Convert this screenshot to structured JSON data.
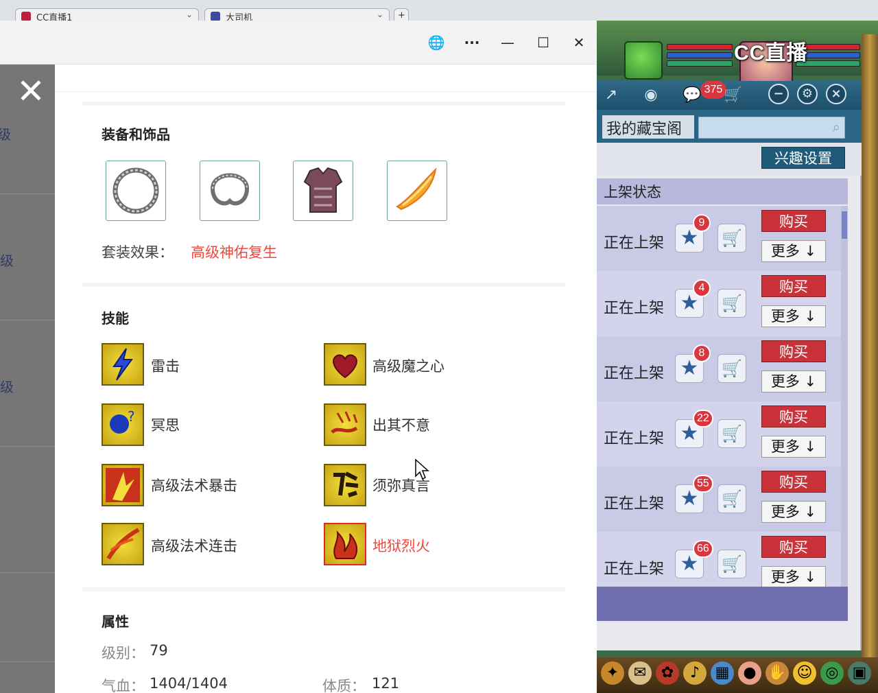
{
  "browser_tabs": [
    {
      "label": "CC直播1"
    },
    {
      "label": "大司机"
    }
  ],
  "game": {
    "logo": "CC直播",
    "message_count": "375",
    "tab_label": "我的藏宝阁",
    "interest_button": "兴趣设置",
    "status_header": "上架状态",
    "rows": [
      {
        "status": "正在上架",
        "count": "9",
        "buy": "购买",
        "more": "更多"
      },
      {
        "status": "正在上架",
        "count": "4",
        "buy": "购买",
        "more": "更多"
      },
      {
        "status": "正在上架",
        "count": "8",
        "buy": "购买",
        "more": "更多"
      },
      {
        "status": "正在上架",
        "count": "22",
        "buy": "购买",
        "more": "更多"
      },
      {
        "status": "正在上架",
        "count": "55",
        "buy": "购买",
        "more": "更多"
      },
      {
        "status": "正在上架",
        "count": "66",
        "buy": "购买",
        "more": "更多"
      }
    ]
  },
  "left_page": {
    "level_labels": [
      "级",
      "级",
      "级"
    ]
  },
  "popup": {
    "equip_section_title": "装备和饰品",
    "set_effect_label": "套装效果：",
    "set_effect_value": "高级神佑复生",
    "skills_section_title": "技能",
    "skills": [
      {
        "name": "雷击"
      },
      {
        "name": "高级魔之心"
      },
      {
        "name": "冥思"
      },
      {
        "name": "出其不意"
      },
      {
        "name": "高级法术暴击"
      },
      {
        "name": "须弥真言"
      },
      {
        "name": "高级法术连击"
      },
      {
        "name": "地狱烈火"
      }
    ],
    "attr_section_title": "属性",
    "attributes": {
      "level_label": "级别：",
      "level_value": "79",
      "hp_label": "气血：",
      "hp_value": "1404/1404",
      "con_label": "体质：",
      "con_value": "121"
    }
  },
  "colors": {
    "accent_red": "#f2463c",
    "game_blue": "#1f5b78",
    "buy_red": "#c83238"
  }
}
